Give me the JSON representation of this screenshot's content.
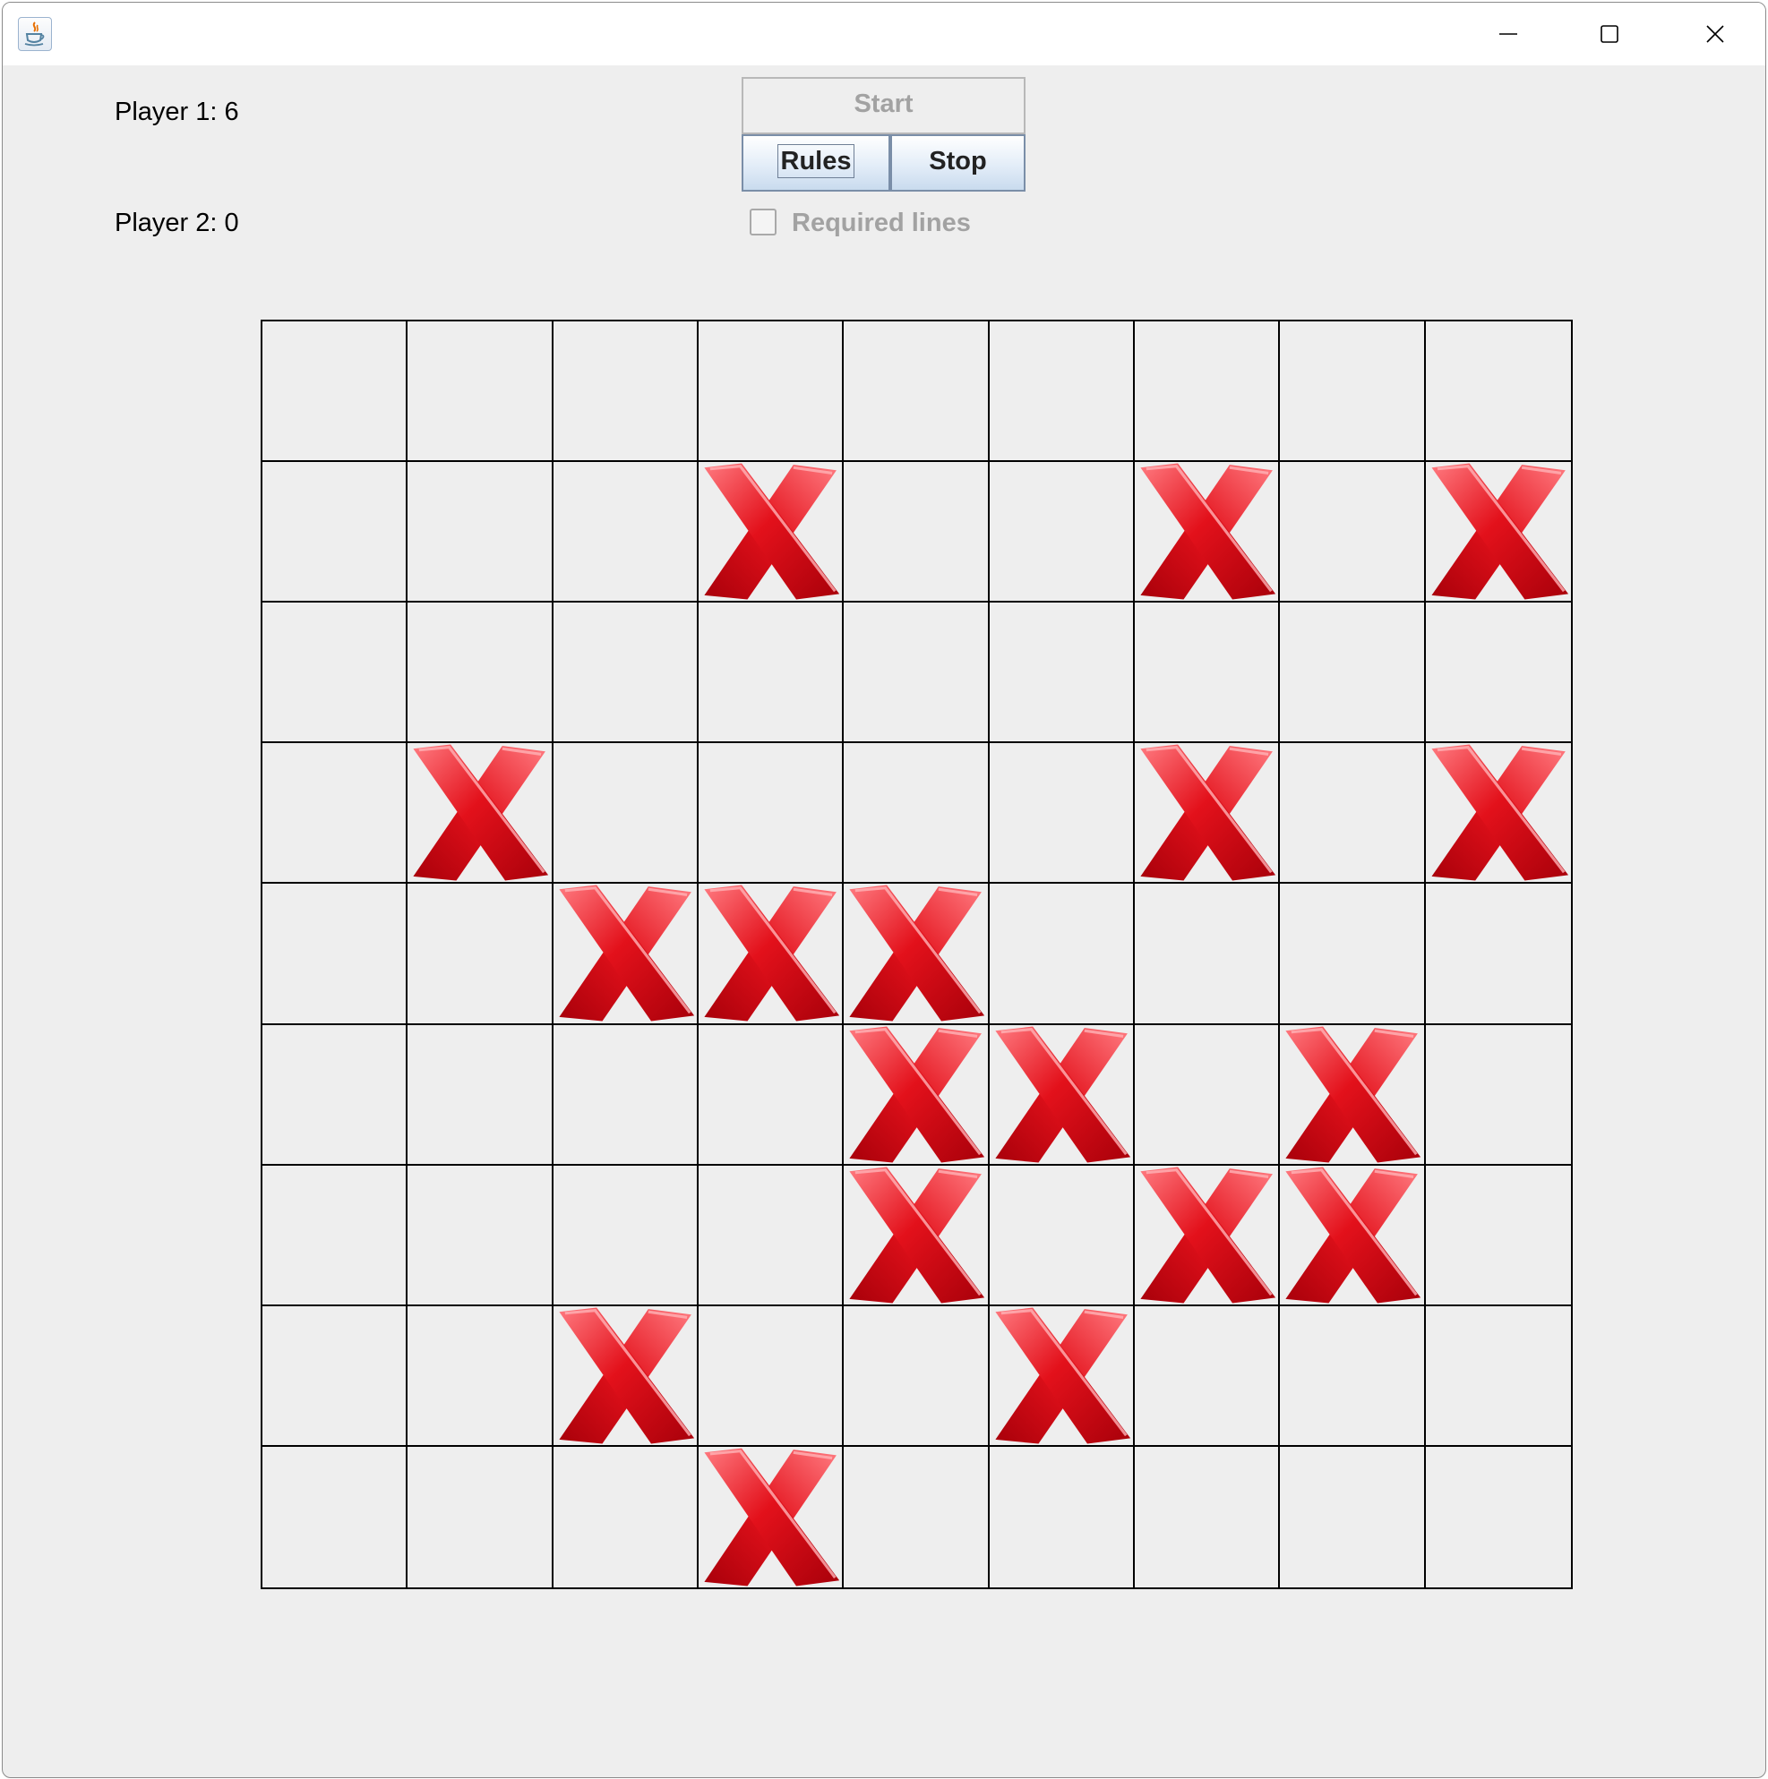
{
  "window": {
    "title": "",
    "controls": [
      "minimize-icon",
      "maximize-icon",
      "close-icon"
    ]
  },
  "scores": {
    "player1": "Player 1: 6",
    "player2": "Player 2: 0"
  },
  "controls": {
    "start_label": "Start",
    "rules_label": "Rules",
    "stop_label": "Stop",
    "required_lines_label": "Required lines",
    "required_lines_checked": false
  },
  "board": {
    "rows": 9,
    "cols": 9,
    "cells": [
      "",
      "",
      "",
      "",
      "",
      "",
      "",
      "",
      "",
      "",
      "",
      "",
      "X",
      "",
      "",
      "X",
      "",
      "X",
      "",
      "",
      "",
      "",
      "",
      "",
      "",
      "",
      "",
      "",
      "X",
      "",
      "",
      "",
      "",
      "X",
      "",
      "X",
      "",
      "",
      "X",
      "X",
      "X",
      "",
      "",
      "",
      "",
      "",
      "",
      "",
      "",
      "X",
      "X",
      "",
      "X",
      "",
      "",
      "",
      "",
      "",
      "X",
      "",
      "X",
      "X",
      "",
      "",
      "",
      "X",
      "",
      "",
      "X",
      "",
      "",
      "",
      "",
      "",
      "",
      "X",
      "",
      "",
      "",
      "",
      ""
    ]
  },
  "colors": {
    "mark_red": "#e3111b",
    "mark_dark": "#a8000a",
    "mark_light": "#ff7a80",
    "grid_line": "#000000",
    "background": "#eeeeee"
  }
}
